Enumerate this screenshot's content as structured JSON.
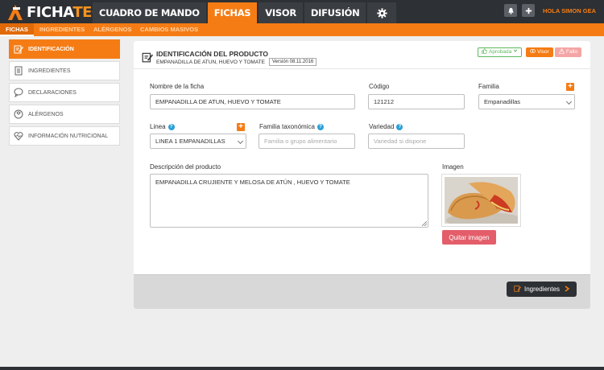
{
  "app": {
    "logo_prefix": "FICHA",
    "logo_suffix": "TEC",
    "greeting": "HOLA SIMON GEA"
  },
  "nav": {
    "items": [
      {
        "label": "CUADRO DE MANDO"
      },
      {
        "label": "FICHAS"
      },
      {
        "label": "VISOR"
      },
      {
        "label": "DIFUSIÓN"
      }
    ],
    "active": "FICHAS"
  },
  "subnav": {
    "items": [
      {
        "label": "FICHAS"
      },
      {
        "label": "INGREDIENTES"
      },
      {
        "label": "ALÉRGENOS"
      },
      {
        "label": "CAMBIOS MASIVOS"
      }
    ]
  },
  "sidebar": {
    "items": [
      {
        "label": "IDENTIFICACIÓN",
        "icon": "edit-document-icon"
      },
      {
        "label": "INGREDIENTES",
        "icon": "list-icon"
      },
      {
        "label": "DECLARACIONES",
        "icon": "speech-bubble-icon"
      },
      {
        "label": "ALÉRGENOS",
        "icon": "allergen-icon"
      },
      {
        "label": "INFORMACIÓN NUTRICIONAL",
        "icon": "heart-pulse-icon"
      }
    ]
  },
  "header": {
    "title": "IDENTIFICACIÓN DEL PRODUCTO",
    "product": "EMPANADILLA DE ATUN, HUEVO Y TOMATE",
    "version": "Versión 08.11.2016",
    "status_aprobada": "Aprobada",
    "status_visor": "Visor",
    "status_fallo": "Fallo"
  },
  "form": {
    "nombre_label": "Nombre de la ficha",
    "nombre_value": "EMPANADILLA DE ATUN, HUEVO Y TOMATE",
    "codigo_label": "Código",
    "codigo_value": "121212",
    "familia_label": "Familia",
    "familia_value": "Empanadillas",
    "linea_label": "Linea",
    "linea_value": "LINEA 1 EMPANADILLAS",
    "familia_tax_label": "Familia taxonómica",
    "familia_tax_placeholder": "Familia o grupo alimentario",
    "variedad_label": "Variedad",
    "variedad_placeholder": "Variedad si dispone",
    "descripcion_label": "Descripción del producto",
    "descripcion_value": "EMPANADILLA CRUJIENTE Y MELOSA DE ATÚN , HUEVO Y TOMATE",
    "imagen_label": "Imagen",
    "quitar_label": "Quitar imagen"
  },
  "footer": {
    "next_label": "Ingredientes"
  },
  "colors": {
    "accent": "#f57c14",
    "dark": "#2d3034",
    "success": "#5cb85c",
    "danger": "#e35e6a"
  }
}
